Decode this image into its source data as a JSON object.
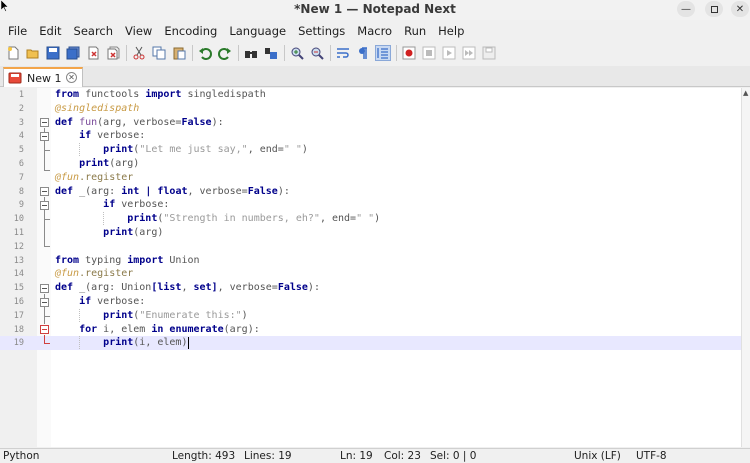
{
  "window": {
    "title": "*New 1 — Notepad Next"
  },
  "menu": [
    "File",
    "Edit",
    "Search",
    "View",
    "Encoding",
    "Language",
    "Settings",
    "Macro",
    "Run",
    "Help"
  ],
  "toolbar_icons": [
    "new-file-icon",
    "open-file-icon",
    "save-icon",
    "save-all-icon",
    "close-icon",
    "close-all-icon",
    "cut-icon",
    "copy-icon",
    "paste-icon",
    "undo-icon",
    "redo-icon",
    "find-icon",
    "replace-icon",
    "zoom-in-icon",
    "zoom-out-icon",
    "word-wrap-icon",
    "show-all-characters-icon",
    "indent-guide-icon",
    "record-macro-icon",
    "stop-macro-icon",
    "play-macro-icon",
    "run-macro-multiple-icon",
    "save-macro-icon"
  ],
  "tab": {
    "label": "New 1",
    "accent": "#f3a54a"
  },
  "editor": {
    "lines": [
      {
        "n": "1",
        "code": "from functools import singledispath"
      },
      {
        "n": "2",
        "code": "@singledispath"
      },
      {
        "n": "3",
        "code": "def fun(arg, verbose=False):"
      },
      {
        "n": "4",
        "code": "    if verbose:"
      },
      {
        "n": "5",
        "code": "        print(\"Let me just say,\", end=\" \")"
      },
      {
        "n": "6",
        "code": "    print(arg)"
      },
      {
        "n": "7",
        "code": "@fun.register"
      },
      {
        "n": "8",
        "code": "def _(arg: int | float, verbose=False):"
      },
      {
        "n": "9",
        "code": "        if verbose:"
      },
      {
        "n": "10",
        "code": "            print(\"Strength in numbers, eh?\", end=\" \")"
      },
      {
        "n": "11",
        "code": "        print(arg)"
      },
      {
        "n": "12",
        "code": ""
      },
      {
        "n": "13",
        "code": "from typing import Union"
      },
      {
        "n": "14",
        "code": "@fun.register"
      },
      {
        "n": "15",
        "code": "def _(arg: Union[list, set], verbose=False):"
      },
      {
        "n": "16",
        "code": "    if verbose:"
      },
      {
        "n": "17",
        "code": "        print(\"Enumerate this:\")"
      },
      {
        "n": "18",
        "code": "    for i, elem in enumerate(arg):"
      },
      {
        "n": "19",
        "code": "        print(i, elem)"
      }
    ],
    "current_line": 19
  },
  "status": {
    "language": "Python",
    "length": "Length: 493",
    "lines": "Lines: 19",
    "ln": "Ln: 19",
    "col": "Col: 23",
    "sel": "Sel: 0 | 0",
    "eol": "Unix (LF)",
    "encoding": "UTF-8"
  }
}
